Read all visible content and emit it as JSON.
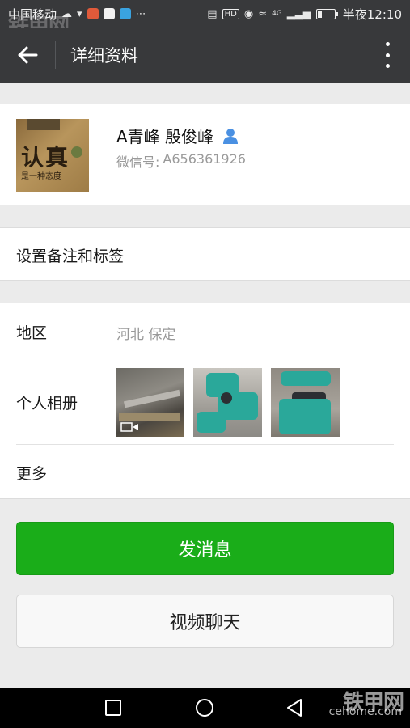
{
  "status_bar": {
    "carrier": "中国移动",
    "time": "半夜12:10",
    "network_label": "4G",
    "hd_label": "HD"
  },
  "watermark": {
    "brand": "铁甲网",
    "site": "cehome.com"
  },
  "header": {
    "title": "详细资料"
  },
  "profile": {
    "name": "A青峰  殷俊峰",
    "wechat_id_label": "微信号:",
    "wechat_id": "A656361926",
    "avatar_text": "认真",
    "avatar_subtext": "是一种态度"
  },
  "remark": {
    "label": "设置备注和标签"
  },
  "info": {
    "region_label": "地区",
    "region_value": "河北  保定",
    "album_label": "个人相册",
    "more_label": "更多"
  },
  "actions": {
    "send_message": "发消息",
    "video_call": "视频聊天"
  },
  "colors": {
    "header_bg": "#38393b",
    "primary_green": "#1aad19",
    "page_bg": "#ebebeb"
  }
}
